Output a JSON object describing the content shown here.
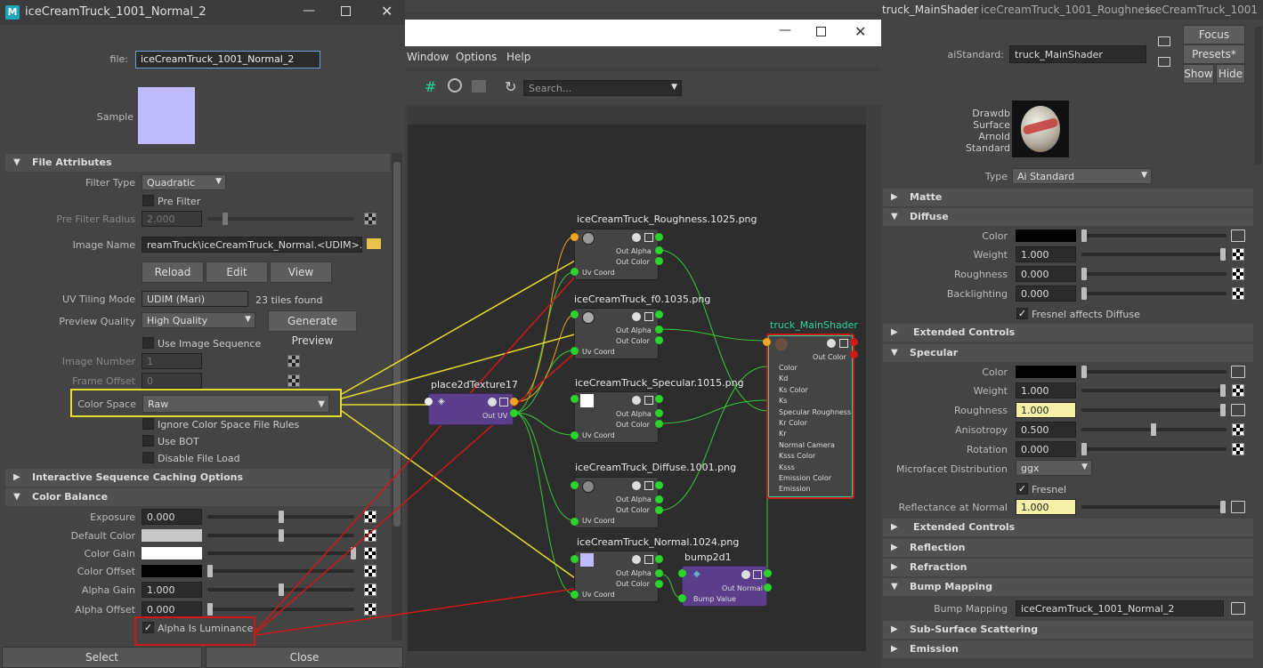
{
  "file_window": {
    "title": "iceCreamTruck_1001_Normal_2",
    "file_label": "file:",
    "file_value": "iceCreamTruck_1001_Normal_2",
    "sample_label": "Sample",
    "sample_color": "#c0bcfc",
    "file_attributes": {
      "header": "File Attributes",
      "filter_type_label": "Filter Type",
      "filter_type_value": "Quadratic",
      "pre_filter_label": "Pre Filter",
      "pre_filter_radius_label": "Pre Filter Radius",
      "pre_filter_radius_value": "2.000",
      "image_name_label": "Image Name",
      "image_name_value": "reamTruck\\iceCreamTruck_Normal.<UDIM>.png",
      "reload": "Reload",
      "edit": "Edit",
      "view": "View",
      "uv_tiling_label": "UV Tiling Mode",
      "uv_tiling_value": "UDIM (Mari)",
      "tiles_found": "23 tiles found",
      "preview_quality_label": "Preview Quality",
      "preview_quality_value": "High Quality",
      "generate_preview": "Generate Preview",
      "use_image_sequence": "Use Image Sequence",
      "image_number_label": "Image Number",
      "image_number_value": "1",
      "frame_offset_label": "Frame Offset",
      "frame_offset_value": "0",
      "color_space_label": "Color Space",
      "color_space_value": "Raw",
      "ignore_cs_rules": "Ignore Color Space File Rules",
      "use_bot": "Use BOT",
      "disable_file_load": "Disable File Load"
    },
    "interactive_header": "Interactive Sequence Caching Options",
    "color_balance": {
      "header": "Color Balance",
      "exposure_label": "Exposure",
      "exposure_value": "0.000",
      "default_color_label": "Default Color",
      "color_gain_label": "Color Gain",
      "color_offset_label": "Color Offset",
      "alpha_gain_label": "Alpha Gain",
      "alpha_gain_value": "1.000",
      "alpha_offset_label": "Alpha Offset",
      "alpha_offset_value": "0.000",
      "alpha_is_luminance": "Alpha Is Luminance"
    },
    "select": "Select",
    "close": "Close"
  },
  "hypershade": {
    "menu": [
      "Window",
      "Options",
      "Help"
    ],
    "search_placeholder": "Search...",
    "nodes": {
      "roughness": {
        "title": "iceCreamTruck_Roughness.1025.png",
        "out_alpha": "Out Alpha",
        "out_color": "Out Color",
        "uv": "Uv Coord"
      },
      "f0": {
        "title": "iceCreamTruck_f0.1035.png",
        "out_alpha": "Out Alpha",
        "out_color": "Out Color",
        "uv": "Uv Coord"
      },
      "specular": {
        "title": "iceCreamTruck_Specular.1015.png",
        "out_alpha": "Out Alpha",
        "out_color": "Out Color",
        "uv": "Uv Coord"
      },
      "diffuse": {
        "title": "iceCreamTruck_Diffuse.1001.png",
        "out_alpha": "Out Alpha",
        "out_color": "Out Color",
        "uv": "Uv Coord"
      },
      "normal": {
        "title": "iceCreamTruck_Normal.1024.png",
        "out_alpha": "Out Alpha",
        "out_color": "Out Color",
        "uv": "Uv Coord"
      },
      "place2d": {
        "title": "place2dTexture17",
        "out_uv": "Out UV"
      },
      "bump": {
        "title": "bump2d1",
        "out_normal": "Out Normal",
        "bump_value": "Bump Value"
      },
      "shader": {
        "title": "truck_MainShader",
        "out_color": "Out Color",
        "ports": [
          "Color",
          "Kd",
          "Ks Color",
          "Ks",
          "Specular Roughness",
          "Kr Color",
          "Kr",
          "Normal Camera",
          "Ksss Color",
          "Ksss",
          "Emission Color",
          "Emission"
        ]
      }
    }
  },
  "attr_editor": {
    "tabs": [
      "truck_MainShader",
      "iceCreamTruck_1001_Roughness",
      "iceCreamTruck_1001"
    ],
    "type_label": "aiStandard:",
    "name_value": "truck_MainShader",
    "focus": "Focus",
    "presets": "Presets*",
    "show": "Show",
    "hide": "Hide",
    "swatch_caption": [
      "Drawdb",
      "Surface",
      "Arnold",
      "Standard"
    ],
    "type_row_label": "Type",
    "type_row_value": "Ai Standard",
    "matte": "Matte",
    "diffuse": "Diffuse",
    "color_label": "Color",
    "weight_label": "Weight",
    "diffuse_weight": "1.000",
    "roughness_label": "Roughness",
    "diffuse_roughness": "0.000",
    "backlighting_label": "Backlighting",
    "backlighting_value": "0.000",
    "fresnel_affects_diffuse": "Fresnel affects Diffuse",
    "extended_controls": "Extended Controls",
    "specular": "Specular",
    "spec_weight": "1.000",
    "spec_roughness": "1.000",
    "anisotropy_label": "Anisotropy",
    "anisotropy_value": "0.500",
    "rotation_label": "Rotation",
    "rotation_value": "0.000",
    "microfacet_label": "Microfacet Distribution",
    "microfacet_value": "ggx",
    "fresnel": "Fresnel",
    "reflectance_label": "Reflectance at Normal",
    "reflectance_value": "1.000",
    "extended_controls2": "Extended Controls",
    "reflection": "Reflection",
    "refraction": "Refraction",
    "bump_mapping": "Bump Mapping",
    "bump_mapping_label": "Bump Mapping",
    "bump_mapping_value": "iceCreamTruck_1001_Normal_2",
    "sss": "Sub-Surface Scattering",
    "emission": "Emission"
  }
}
